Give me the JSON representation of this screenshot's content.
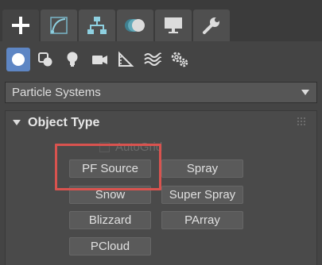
{
  "tabs": [
    {
      "name": "create",
      "icon": "plus-icon",
      "active": true
    },
    {
      "name": "modify",
      "icon": "curve-icon",
      "active": false
    },
    {
      "name": "hierarchy",
      "icon": "hierarchy-icon",
      "active": false
    },
    {
      "name": "motion",
      "icon": "motion-circles-icon",
      "active": false
    },
    {
      "name": "display",
      "icon": "monitor-icon",
      "active": false
    },
    {
      "name": "utilities",
      "icon": "wrench-icon",
      "active": false
    }
  ],
  "subcategories": [
    {
      "name": "geometry",
      "icon": "sphere-icon",
      "active": true
    },
    {
      "name": "shapes",
      "icon": "shapes-icon",
      "active": false
    },
    {
      "name": "lights",
      "icon": "lightbulb-icon",
      "active": false
    },
    {
      "name": "cameras",
      "icon": "camera-icon",
      "active": false
    },
    {
      "name": "helpers",
      "icon": "ruler-triangle-icon",
      "active": false
    },
    {
      "name": "space-warps",
      "icon": "waves-icon",
      "active": false
    },
    {
      "name": "systems",
      "icon": "gears-icon",
      "active": false
    }
  ],
  "dropdown": {
    "value": "Particle Systems"
  },
  "object_type": {
    "title": "Object Type",
    "autogrid_label": "AutoGrid",
    "autogrid_checked": false,
    "autogrid_enabled": false,
    "buttons": [
      "PF Source",
      "Spray",
      "Snow",
      "Super Spray",
      "Blizzard",
      "PArray",
      "PCloud"
    ]
  },
  "colors": {
    "accent": "#5e86c4",
    "highlight": "#d9534f",
    "panel": "#444444",
    "text": "#dcdcdc"
  }
}
